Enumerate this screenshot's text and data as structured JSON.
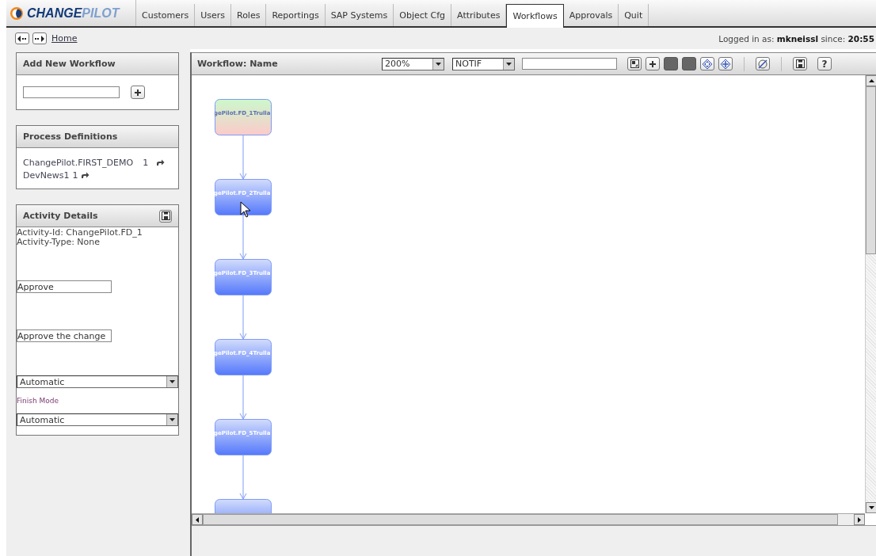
{
  "logo": {
    "part1": "CHANGE",
    "part2": "PILOT"
  },
  "tabs": [
    {
      "label": "Customers",
      "selected": false
    },
    {
      "label": "Users",
      "selected": false
    },
    {
      "label": "Roles",
      "selected": false
    },
    {
      "label": "Reportings",
      "selected": false
    },
    {
      "label": "SAP Systems",
      "selected": false
    },
    {
      "label": "Object Cfg",
      "selected": false
    },
    {
      "label": "Attributes",
      "selected": false
    },
    {
      "label": "Workflows",
      "selected": true
    },
    {
      "label": "Approvals",
      "selected": false
    },
    {
      "label": "Quit",
      "selected": false
    }
  ],
  "breadcrumb": {
    "home": "Home"
  },
  "session": {
    "prefix": "Logged in as:",
    "user": "mkneissl",
    "since_label": "since:",
    "time": "20:55"
  },
  "add_workflow": {
    "title": "Add New Workflow"
  },
  "process_definitions": {
    "title": "Process Definitions",
    "items": [
      {
        "name": "ChangePilot.FIRST_DEMO",
        "version": "1"
      },
      {
        "name": "DevNews1",
        "version": "1"
      }
    ]
  },
  "activity_details": {
    "title": "Activity Details",
    "id_line": "Activity-Id: ChangePilot.FD_1",
    "type_line": "Activity-Type: None",
    "name_value": "Approve",
    "description_value": "Approve the change",
    "start_mode": "Automatic",
    "finish_label": "Finish Mode",
    "finish_mode": "Automatic"
  },
  "workflow": {
    "title": "Workflow: Name",
    "zoom": "200%",
    "filter": "NOTIF",
    "help": "?",
    "nodes": [
      {
        "kind": "start",
        "label": "gePilot.FD_1Trulla"
      },
      {
        "kind": "activity",
        "label": "gePilot.FD_2Trulla"
      },
      {
        "kind": "activity",
        "label": "gePilot.FD_3Trulla"
      },
      {
        "kind": "activity",
        "label": "gePilot.FD_4Trulla"
      },
      {
        "kind": "activity",
        "label": "gePilot.FD_5Trulla"
      },
      {
        "kind": "activity"
      }
    ]
  }
}
